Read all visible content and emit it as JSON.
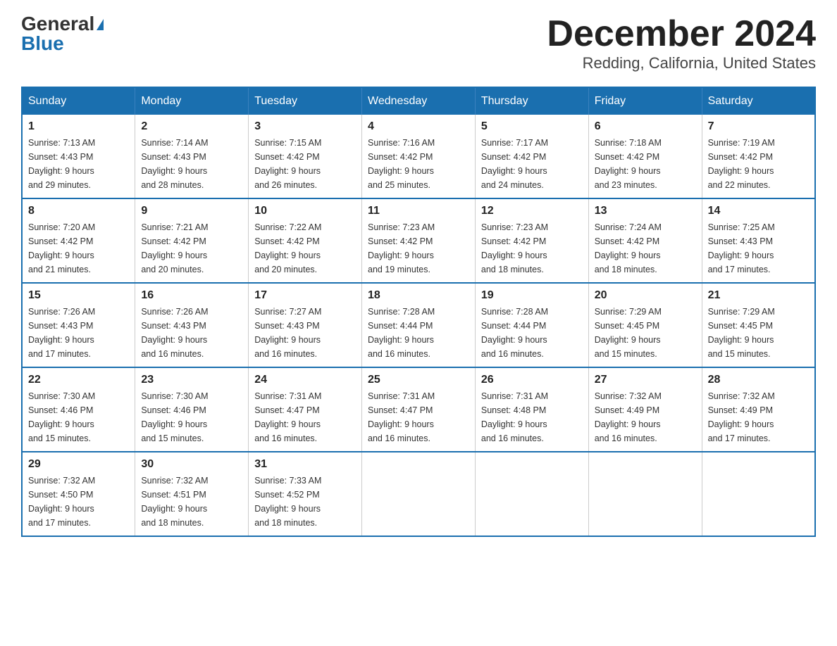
{
  "header": {
    "logo_general": "General",
    "logo_blue": "Blue",
    "month_title": "December 2024",
    "location": "Redding, California, United States"
  },
  "weekdays": [
    "Sunday",
    "Monday",
    "Tuesday",
    "Wednesday",
    "Thursday",
    "Friday",
    "Saturday"
  ],
  "weeks": [
    [
      {
        "day": "1",
        "sunrise": "7:13 AM",
        "sunset": "4:43 PM",
        "daylight": "9 hours and 29 minutes."
      },
      {
        "day": "2",
        "sunrise": "7:14 AM",
        "sunset": "4:43 PM",
        "daylight": "9 hours and 28 minutes."
      },
      {
        "day": "3",
        "sunrise": "7:15 AM",
        "sunset": "4:42 PM",
        "daylight": "9 hours and 26 minutes."
      },
      {
        "day": "4",
        "sunrise": "7:16 AM",
        "sunset": "4:42 PM",
        "daylight": "9 hours and 25 minutes."
      },
      {
        "day": "5",
        "sunrise": "7:17 AM",
        "sunset": "4:42 PM",
        "daylight": "9 hours and 24 minutes."
      },
      {
        "day": "6",
        "sunrise": "7:18 AM",
        "sunset": "4:42 PM",
        "daylight": "9 hours and 23 minutes."
      },
      {
        "day": "7",
        "sunrise": "7:19 AM",
        "sunset": "4:42 PM",
        "daylight": "9 hours and 22 minutes."
      }
    ],
    [
      {
        "day": "8",
        "sunrise": "7:20 AM",
        "sunset": "4:42 PM",
        "daylight": "9 hours and 21 minutes."
      },
      {
        "day": "9",
        "sunrise": "7:21 AM",
        "sunset": "4:42 PM",
        "daylight": "9 hours and 20 minutes."
      },
      {
        "day": "10",
        "sunrise": "7:22 AM",
        "sunset": "4:42 PM",
        "daylight": "9 hours and 20 minutes."
      },
      {
        "day": "11",
        "sunrise": "7:23 AM",
        "sunset": "4:42 PM",
        "daylight": "9 hours and 19 minutes."
      },
      {
        "day": "12",
        "sunrise": "7:23 AM",
        "sunset": "4:42 PM",
        "daylight": "9 hours and 18 minutes."
      },
      {
        "day": "13",
        "sunrise": "7:24 AM",
        "sunset": "4:42 PM",
        "daylight": "9 hours and 18 minutes."
      },
      {
        "day": "14",
        "sunrise": "7:25 AM",
        "sunset": "4:43 PM",
        "daylight": "9 hours and 17 minutes."
      }
    ],
    [
      {
        "day": "15",
        "sunrise": "7:26 AM",
        "sunset": "4:43 PM",
        "daylight": "9 hours and 17 minutes."
      },
      {
        "day": "16",
        "sunrise": "7:26 AM",
        "sunset": "4:43 PM",
        "daylight": "9 hours and 16 minutes."
      },
      {
        "day": "17",
        "sunrise": "7:27 AM",
        "sunset": "4:43 PM",
        "daylight": "9 hours and 16 minutes."
      },
      {
        "day": "18",
        "sunrise": "7:28 AM",
        "sunset": "4:44 PM",
        "daylight": "9 hours and 16 minutes."
      },
      {
        "day": "19",
        "sunrise": "7:28 AM",
        "sunset": "4:44 PM",
        "daylight": "9 hours and 16 minutes."
      },
      {
        "day": "20",
        "sunrise": "7:29 AM",
        "sunset": "4:45 PM",
        "daylight": "9 hours and 15 minutes."
      },
      {
        "day": "21",
        "sunrise": "7:29 AM",
        "sunset": "4:45 PM",
        "daylight": "9 hours and 15 minutes."
      }
    ],
    [
      {
        "day": "22",
        "sunrise": "7:30 AM",
        "sunset": "4:46 PM",
        "daylight": "9 hours and 15 minutes."
      },
      {
        "day": "23",
        "sunrise": "7:30 AM",
        "sunset": "4:46 PM",
        "daylight": "9 hours and 15 minutes."
      },
      {
        "day": "24",
        "sunrise": "7:31 AM",
        "sunset": "4:47 PM",
        "daylight": "9 hours and 16 minutes."
      },
      {
        "day": "25",
        "sunrise": "7:31 AM",
        "sunset": "4:47 PM",
        "daylight": "9 hours and 16 minutes."
      },
      {
        "day": "26",
        "sunrise": "7:31 AM",
        "sunset": "4:48 PM",
        "daylight": "9 hours and 16 minutes."
      },
      {
        "day": "27",
        "sunrise": "7:32 AM",
        "sunset": "4:49 PM",
        "daylight": "9 hours and 16 minutes."
      },
      {
        "day": "28",
        "sunrise": "7:32 AM",
        "sunset": "4:49 PM",
        "daylight": "9 hours and 17 minutes."
      }
    ],
    [
      {
        "day": "29",
        "sunrise": "7:32 AM",
        "sunset": "4:50 PM",
        "daylight": "9 hours and 17 minutes."
      },
      {
        "day": "30",
        "sunrise": "7:32 AM",
        "sunset": "4:51 PM",
        "daylight": "9 hours and 18 minutes."
      },
      {
        "day": "31",
        "sunrise": "7:33 AM",
        "sunset": "4:52 PM",
        "daylight": "9 hours and 18 minutes."
      },
      null,
      null,
      null,
      null
    ]
  ],
  "labels": {
    "sunrise": "Sunrise:",
    "sunset": "Sunset:",
    "daylight": "Daylight:"
  }
}
